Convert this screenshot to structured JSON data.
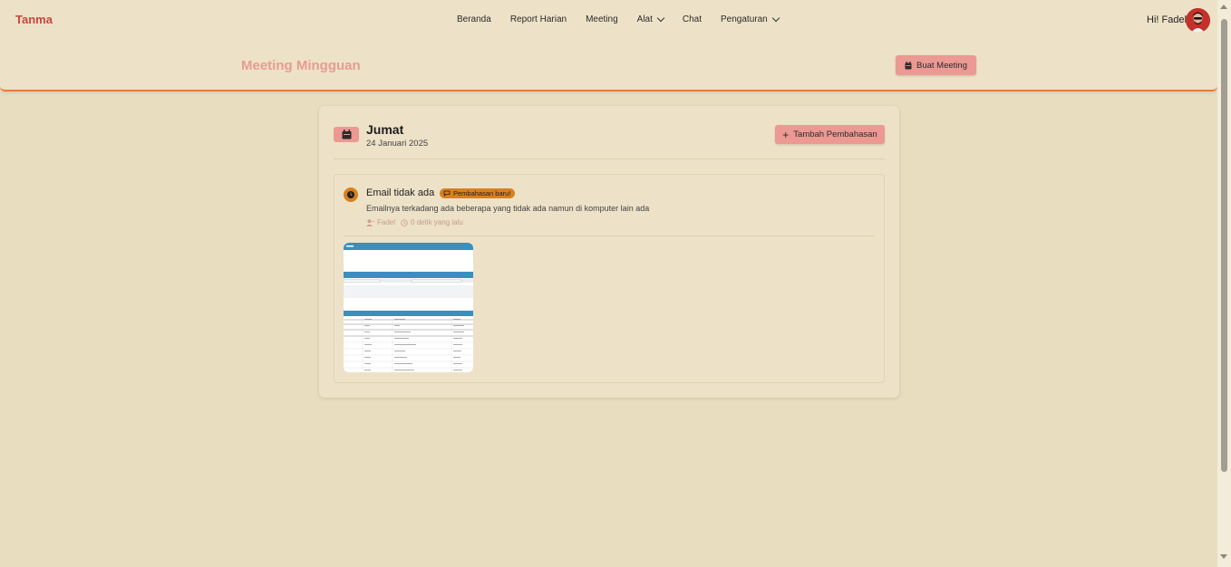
{
  "brand": "Tanma",
  "nav": {
    "items": [
      {
        "label": "Beranda",
        "dropdown": false
      },
      {
        "label": "Report Harian",
        "dropdown": false
      },
      {
        "label": "Meeting",
        "dropdown": false
      },
      {
        "label": "Alat",
        "dropdown": true
      },
      {
        "label": "Chat",
        "dropdown": false
      },
      {
        "label": "Pengaturan",
        "dropdown": true
      }
    ],
    "greeting": "Hi! Fadel"
  },
  "header": {
    "title": "Meeting Mingguan",
    "create_button": "Buat Meeting"
  },
  "meeting": {
    "day": "Jumat",
    "date": "24 Januari 2025",
    "add_button": "Tambah Pembahasan",
    "topics": [
      {
        "title": "Email tidak ada",
        "badge": "Pembahasan baru!",
        "description": "Emailnya terkadang ada beberapa yang tidak ada namun di komputer lain ada",
        "author": "Fadel",
        "time": "0 detik yang lalu"
      }
    ]
  },
  "colors": {
    "background": "#e9ddbf",
    "brand": "#c8463b",
    "accent_button": "#ec9893",
    "badge": "#d8801f",
    "header_border": "#e8793a",
    "title": "#e89b92"
  }
}
